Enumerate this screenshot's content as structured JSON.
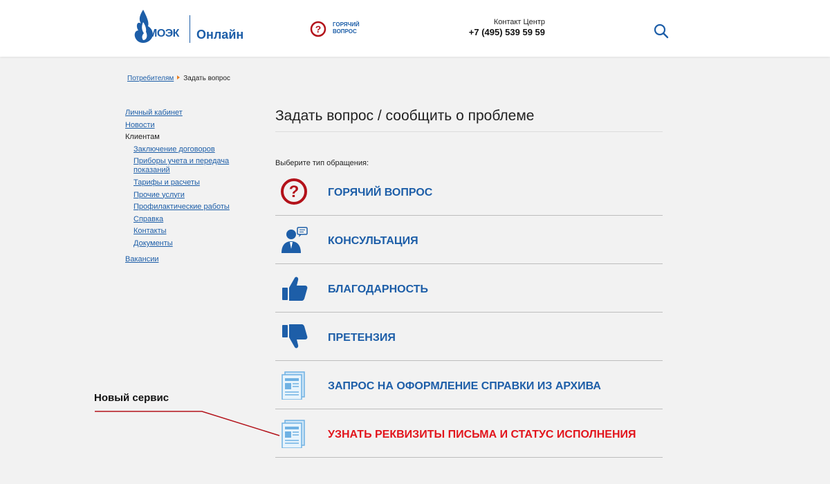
{
  "header": {
    "logo_text": "МОЭК",
    "logo_sub": "Онлайн",
    "hot_question": "ГОРЯЧИЙ ВОПРОС",
    "contact_label": "Контакт Центр",
    "contact_phone": "+7 (495) 539 59 59"
  },
  "breadcrumb": {
    "parent": "Потребителям",
    "current": "Задать вопрос"
  },
  "sidebar": {
    "items": [
      {
        "label": "Личный кабинет"
      },
      {
        "label": "Новости"
      },
      {
        "label": "Клиентам"
      },
      {
        "label": "Заключение договоров"
      },
      {
        "label": "Приборы учета и передача показаний"
      },
      {
        "label": "Тарифы и расчеты"
      },
      {
        "label": "Прочие услуги"
      },
      {
        "label": "Профилактические работы"
      },
      {
        "label": "Справка"
      },
      {
        "label": "Контакты"
      },
      {
        "label": "Документы"
      },
      {
        "label": "Вакансии"
      }
    ]
  },
  "main": {
    "title": "Задать вопрос / сообщить о проблеме",
    "prompt": "Выберите тип обращения:",
    "options": [
      {
        "label": "ГОРЯЧИЙ ВОПРОС",
        "icon": "question-icon"
      },
      {
        "label": "КОНСУЛЬТАЦИЯ",
        "icon": "consultant-icon"
      },
      {
        "label": "БЛАГОДАРНОСТЬ",
        "icon": "thumbs-up-icon"
      },
      {
        "label": "ПРЕТЕНЗИЯ",
        "icon": "thumbs-down-icon"
      },
      {
        "label": "ЗАПРОС НА ОФОРМЛЕНИЕ СПРАВКИ ИЗ АРХИВА",
        "icon": "document-icon"
      },
      {
        "label": "УЗНАТЬ РЕКВИЗИТЫ ПИСЬМА И СТАТУС ИСПОЛНЕНИЯ",
        "icon": "document-icon",
        "color": "#e2141c"
      }
    ]
  },
  "annotation": {
    "text": "Новый сервис",
    "line_color": "#b3121a"
  },
  "colors": {
    "brand_blue": "#1d5ea8",
    "hot_red": "#b3121a",
    "accent_orange": "#e87e20"
  }
}
